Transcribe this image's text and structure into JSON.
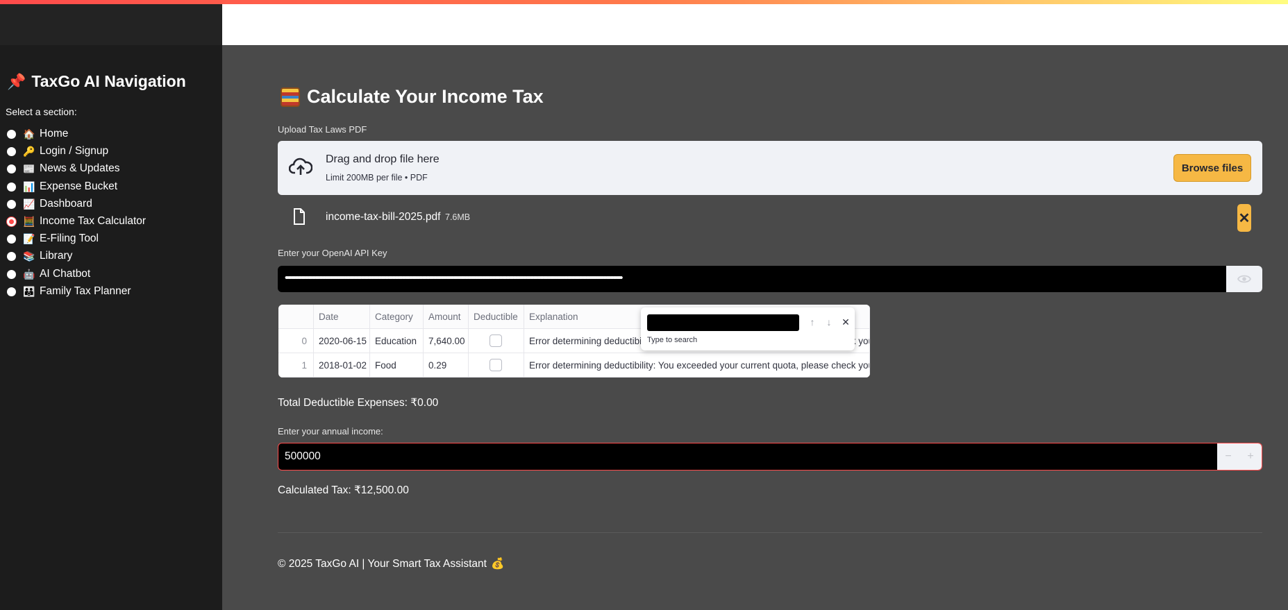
{
  "sidebar": {
    "title": "TaxGo AI Navigation",
    "title_icon": "pushpin-icon",
    "select_label": "Select a section:",
    "items": [
      {
        "icon": "🏠",
        "label": "Home",
        "selected": false
      },
      {
        "icon": "🔑",
        "label": "Login / Signup",
        "selected": false
      },
      {
        "icon": "📰",
        "label": "News & Updates",
        "selected": false
      },
      {
        "icon": "📊",
        "label": "Expense Bucket",
        "selected": false
      },
      {
        "icon": "📈",
        "label": "Dashboard",
        "selected": false
      },
      {
        "icon": "🧮",
        "label": "Income Tax Calculator",
        "selected": true
      },
      {
        "icon": "📝",
        "label": "E-Filing Tool",
        "selected": false
      },
      {
        "icon": "📚",
        "label": "Library",
        "selected": false
      },
      {
        "icon": "🤖",
        "label": "AI Chatbot",
        "selected": false
      },
      {
        "icon": "👪",
        "label": "Family Tax Planner",
        "selected": false
      }
    ]
  },
  "main": {
    "title": "Calculate Your Income Tax",
    "upload": {
      "label": "Upload Tax Laws PDF",
      "drop_text": "Drag and drop file here",
      "limit_text": "Limit 200MB per file • PDF",
      "browse_label": "Browse files",
      "file_name": "income-tax-bill-2025.pdf",
      "file_size": "7.6MB"
    },
    "api_key": {
      "label": "Enter your OpenAI API Key",
      "masked_value": "••••••••••••••••••••••••••••••••••••••••••••••••••••••••••••••••••••••••••••••••••••••••••••••••••••••••••••••••••••••••••••••••••••••••••••••••••••••••••••••••••••••••••••••••••••••••••••••••••••••••••••••••••••••••••••••••••••••••••••"
    },
    "table": {
      "columns": [
        "",
        "Date",
        "Category",
        "Amount",
        "Deductible",
        "Explanation"
      ],
      "rows": [
        {
          "index": "0",
          "date": "2020-06-15",
          "category": "Education",
          "amount": "7,640.00",
          "deductible": false,
          "explanation": "Error determining deductibility: You exceeded your current quota, please check your"
        },
        {
          "index": "1",
          "date": "2018-01-02",
          "category": "Food",
          "amount": "0.29",
          "deductible": false,
          "explanation": "Error determining deductibility: You exceeded your current quota, please check your"
        }
      ],
      "search": {
        "hint": "Type to search"
      }
    },
    "total_deductible": "Total Deductible Expenses: ₹0.00",
    "income": {
      "label": "Enter your annual income:",
      "value": "500000"
    },
    "calculated_tax": "Calculated Tax: ₹12,500.00",
    "footer": "© 2025 TaxGo AI | Your Smart Tax Assistant",
    "footer_icon": "money-bag-icon"
  }
}
